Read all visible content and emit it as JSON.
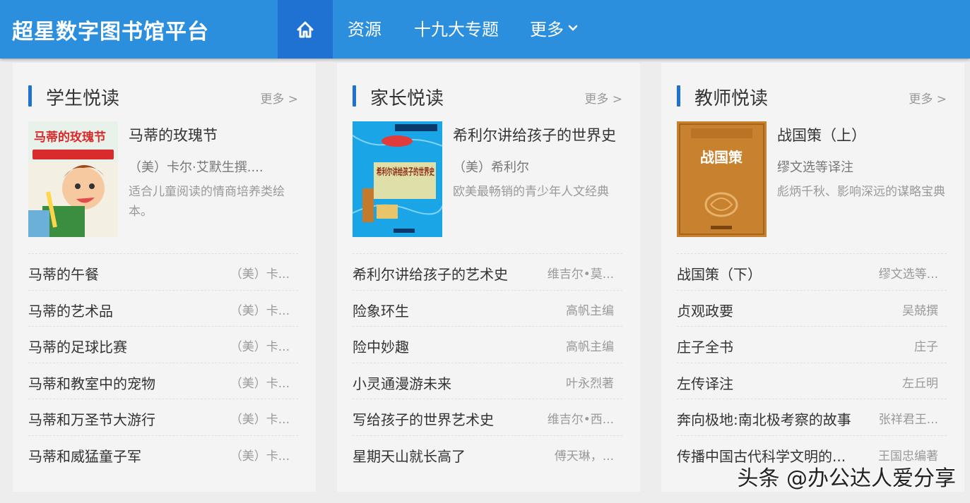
{
  "header": {
    "brand": "超星数字图书馆平台",
    "nav": [
      "资源",
      "十九大专题"
    ],
    "more": "更多"
  },
  "panels": [
    {
      "title": "学生悦读",
      "more": "更多 >",
      "feature": {
        "title": "马蒂的玫瑰节",
        "author": "（美）卡尔·艾默生撰....",
        "desc": "适合儿童阅读的情商培养类绘本。",
        "cover_text": "马蒂的玫瑰节"
      },
      "rows": [
        {
          "title": "马蒂的午餐",
          "author": "（美）卡..."
        },
        {
          "title": "马蒂的艺术品",
          "author": "（美）卡..."
        },
        {
          "title": "马蒂的足球比赛",
          "author": "（美）卡..."
        },
        {
          "title": "马蒂和教室中的宠物",
          "author": "（美）卡..."
        },
        {
          "title": "马蒂和万圣节大游行",
          "author": "（美）卡..."
        },
        {
          "title": "马蒂和威猛童子军",
          "author": "（美）卡..."
        }
      ]
    },
    {
      "title": "家长悦读",
      "more": "更多 >",
      "feature": {
        "title": "希利尔讲给孩子的世界史",
        "author": "（美）希利尔",
        "desc": "欧美最畅销的青少年人文经典",
        "cover_text": "希利尔讲给孩子的世界史"
      },
      "rows": [
        {
          "title": "希利尔讲给孩子的艺术史",
          "author": "维吉尔•莫..."
        },
        {
          "title": "险象环生",
          "author": "高帆主编"
        },
        {
          "title": "险中妙趣",
          "author": "高帆主编"
        },
        {
          "title": "小灵通漫游未来",
          "author": "叶永烈著"
        },
        {
          "title": "写给孩子的世界艺术史",
          "author": "维吉尔•西..."
        },
        {
          "title": "星期天山就长高了",
          "author": "傅天琳，..."
        }
      ]
    },
    {
      "title": "教师悦读",
      "more": "更多 >",
      "feature": {
        "title": "战国策（上）",
        "author": "缪文选等译注",
        "desc": "彪炳千秋、影响深远的谋略宝典",
        "cover_text": "战国策"
      },
      "rows": [
        {
          "title": "战国策（下）",
          "author": "缪文选等..."
        },
        {
          "title": "贞观政要",
          "author": "吴兢撰"
        },
        {
          "title": "庄子全书",
          "author": "庄子"
        },
        {
          "title": "左传译注",
          "author": "左丘明"
        },
        {
          "title": "奔向极地:南北极考察的故事",
          "author": "张祥君王..."
        },
        {
          "title": "传播中国古代科学文明的...",
          "author": "王国忠编著"
        }
      ]
    }
  ],
  "watermark": "头条 @办公达人爱分享",
  "colors": {
    "header": "#2b8fdd",
    "header_active": "#1f72d1",
    "accent_bar": "#1f72d1",
    "page_bg": "#eeeded",
    "panel_bg": "#f5f4f5"
  },
  "icons": {
    "home": "home-icon",
    "more": "chevron-down-icon"
  }
}
